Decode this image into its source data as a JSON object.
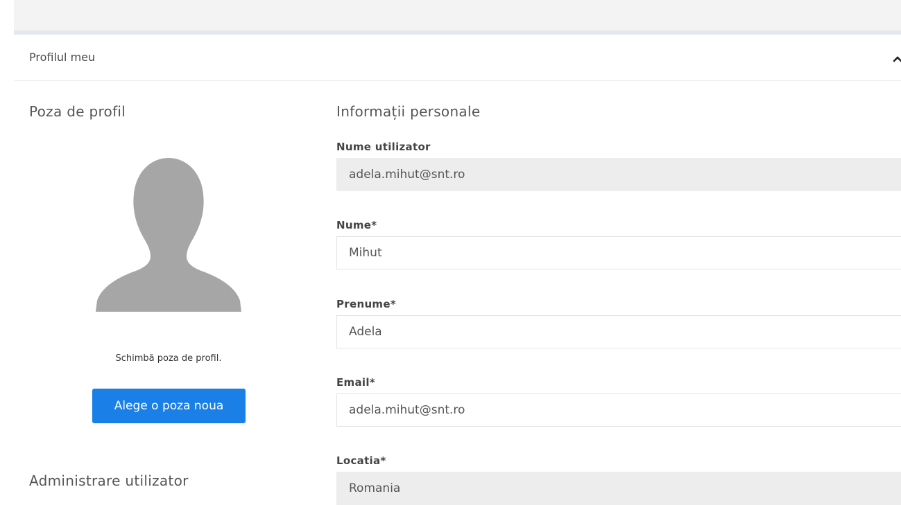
{
  "panel": {
    "title": "Profilul meu",
    "collapse_icon": "chevron-up-icon"
  },
  "profile_picture": {
    "title": "Poza de profil",
    "avatar_icon": "user-silhouette-icon",
    "avatar_color": "#a6a6a6",
    "caption": "Schimbă poza de profil.",
    "button_label": "Alege o poza noua",
    "button_color": "#1a7fe6"
  },
  "admin": {
    "title": "Administrare utilizator"
  },
  "personal_info": {
    "title": "Informații personale",
    "fields": [
      {
        "label": "Nume utilizator",
        "value": "adela.mihut@snt.ro",
        "readonly": true
      },
      {
        "label": "Nume*",
        "value": "Mihut",
        "readonly": false
      },
      {
        "label": "Prenume*",
        "value": "Adela",
        "readonly": false
      },
      {
        "label": "Email*",
        "value": "adela.mihut@snt.ro",
        "readonly": false
      },
      {
        "label": "Locatia*",
        "value": "Romania",
        "readonly": true
      }
    ]
  }
}
